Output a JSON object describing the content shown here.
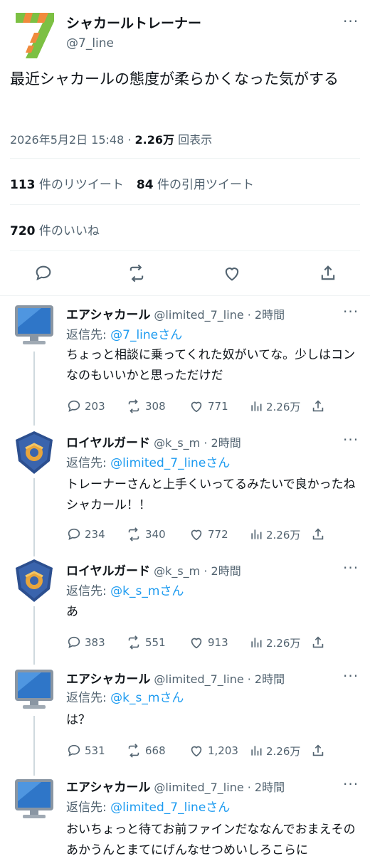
{
  "main_tweet": {
    "display_name": "シャカールトレーナー",
    "handle": "@7_line",
    "text": "最近シャカールの態度が柔らかくなった気がする",
    "datetime": "2026年5月2日 15:48 · ",
    "views": "2.26万",
    "views_label": " 回表示",
    "retweets": "113",
    "retweets_label": " 件のリツイート",
    "quotes": "84",
    "quotes_label": " 件の引用ツイート",
    "likes": "720",
    "likes_label": " 件のいいね"
  },
  "icons": {
    "avatar_main": "green-seven-logo",
    "avatar_air": "monitor-icon",
    "avatar_royal": "shield-emblem",
    "reply": "comment-icon",
    "retweet": "retweet-icon",
    "like": "heart-icon",
    "views": "bar-chart-icon",
    "share": "share-icon",
    "more": "more-icon"
  },
  "more_label": "···",
  "replies": [
    {
      "name": "エアシャカール",
      "handle": "@limited_7_line",
      "time": " · 2時間",
      "reply_prefix": "返信先: ",
      "reply_to": "@7_lineさん",
      "text": "ちょっと相談に乗ってくれた奴がいてな。少しはコンなのもいいかと思っただけだ",
      "replies": "203",
      "retweets": "308",
      "likes": "771",
      "views": "2.26万",
      "avatar": "air"
    },
    {
      "name": "ロイヤルガード",
      "handle": "@k_s_m",
      "time": " · 2時間",
      "reply_prefix": "返信先: ",
      "reply_to": "@limited_7_lineさん",
      "text": "トレーナーさんと上手くいってるみたいで良かったねシャカール！！",
      "replies": "234",
      "retweets": "340",
      "likes": "772",
      "views": "2.26万",
      "avatar": "royal"
    },
    {
      "name": "ロイヤルガード",
      "handle": "@k_s_m",
      "time": " · 2時間",
      "reply_prefix": "返信先: ",
      "reply_to": "@k_s_mさん",
      "text": "あ",
      "replies": "383",
      "retweets": "551",
      "likes": "913",
      "views": "2.26万",
      "avatar": "royal"
    },
    {
      "name": "エアシャカール",
      "handle": "@limited_7_line",
      "time": " · 2時間",
      "reply_prefix": "返信先: ",
      "reply_to": "@k_s_mさん",
      "text": "は？",
      "replies": "531",
      "retweets": "668",
      "likes": "1,203",
      "views": "2.26万",
      "avatar": "air"
    },
    {
      "name": "エアシャカール",
      "handle": "@limited_7_line",
      "time": " · 2時間",
      "reply_prefix": "返信先: ",
      "reply_to": "@limited_7_lineさん",
      "text": "おいちょっと待てお前ファインだななんでおまえそのあかうんとまてにげんなせつめいしろこらに",
      "avatar": "air"
    }
  ],
  "colors": {
    "link": "#1d9bf0",
    "muted": "#536471",
    "divider": "#eff3f4"
  }
}
